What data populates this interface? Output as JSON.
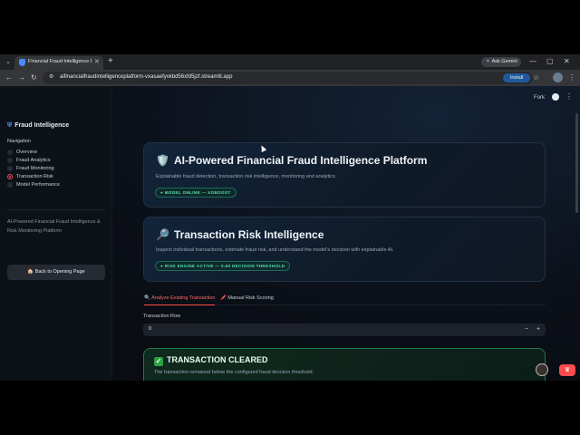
{
  "browser": {
    "tab_title": "Financial Fraud Intelligence Pla",
    "gemini_label": "Ask Gemini",
    "url": "aifinancialfraudintelligenceplatform-vxasaefyvkbd56xfd5jzf.streamlit.app",
    "install_label": "Install"
  },
  "header": {
    "fork_label": "Fork"
  },
  "sidebar": {
    "title": "Fraud Intelligence",
    "nav_label": "Navigation",
    "nav_items": [
      {
        "label": "Overview",
        "selected": false
      },
      {
        "label": "Fraud Analytics",
        "selected": false
      },
      {
        "label": "Fraud Monitoring",
        "selected": false
      },
      {
        "label": "Transaction Risk",
        "selected": true
      },
      {
        "label": "Model Performance",
        "selected": false
      }
    ],
    "description": "AI-Powered Financial Fraud Intelligence & Risk Monitoring Platform",
    "back_button": "🏠 Back to Opening Page"
  },
  "hero": {
    "icon": "🛡️",
    "title": "AI-Powered Financial Fraud Intelligence Platform",
    "subtitle": "Explainable fraud detection, transaction risk intelligence, monitoring and analytics",
    "badge": "● MODEL ONLINE — XGBOOST"
  },
  "risk_card": {
    "icon": "🔎",
    "title": "Transaction Risk Intelligence",
    "subtitle": "Inspect individual transactions, estimate fraud risk, and understand the model's decision with explainable AI.",
    "badge": "● RISK ENGINE ACTIVE — 0.50 DECISION THRESHOLD"
  },
  "tabs": [
    {
      "label": "🔍 Analyze Existing Transaction",
      "active": true
    },
    {
      "label": "🖍️ Manual Risk Scoring",
      "active": false
    }
  ],
  "transaction_row": {
    "label": "Transaction Row",
    "value": "0",
    "minus": "−",
    "plus": "+"
  },
  "result": {
    "icon": "✓",
    "title": "TRANSACTION CLEARED",
    "subtitle": "The transaction remained below the configured fraud decision threshold."
  },
  "colors": {
    "accent": "#ff4b4b",
    "badge_green": "#5fe0b5",
    "cleared_border": "#1f7a4a"
  }
}
